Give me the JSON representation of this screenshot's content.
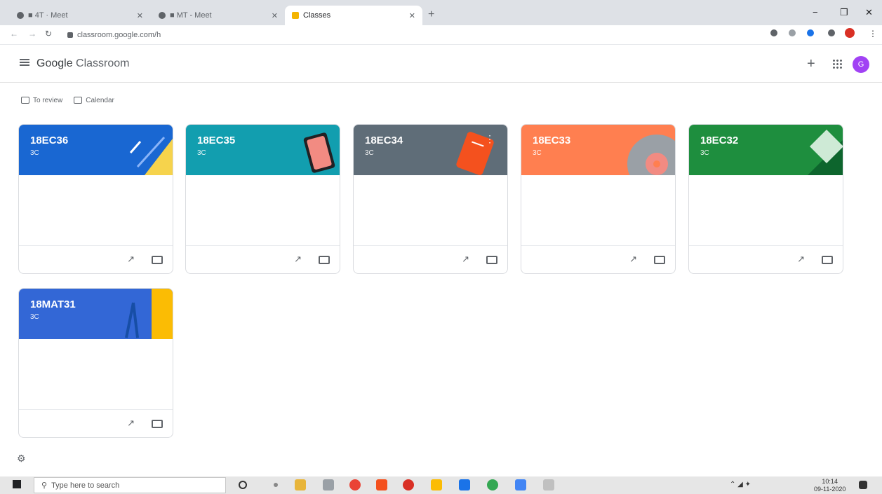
{
  "browser": {
    "tabs": [
      {
        "label": "■ 4T · Meet"
      },
      {
        "label": "■ MT - Meet"
      },
      {
        "label": "Classes"
      }
    ],
    "new_tab": "+",
    "url": "classroom.google.com/h",
    "window": {
      "minimize": "−",
      "maximize": "❐",
      "close": "✕"
    }
  },
  "app": {
    "brand_google": "Google",
    "brand_product": " Classroom",
    "avatar_initial": "G"
  },
  "subnav": {
    "todo": "To review",
    "calendar": "Calendar"
  },
  "cards": [
    {
      "title": "18EC36",
      "subtitle": "3C",
      "color": "#1967d2"
    },
    {
      "title": "18EC35",
      "subtitle": "3C",
      "color": "#129eaf"
    },
    {
      "title": "18EC34",
      "subtitle": "3C",
      "color": "#5f6d78"
    },
    {
      "title": "18EC33",
      "subtitle": "3C",
      "color": "#ff7f50"
    },
    {
      "title": "18EC32",
      "subtitle": "3C",
      "color": "#1e8e3e"
    },
    {
      "title": "18MAT31",
      "subtitle": "3C",
      "color": "#3367d6"
    }
  ],
  "taskbar": {
    "search_placeholder": "Type here to search",
    "time": "10:14",
    "date": "09-11-2020"
  }
}
